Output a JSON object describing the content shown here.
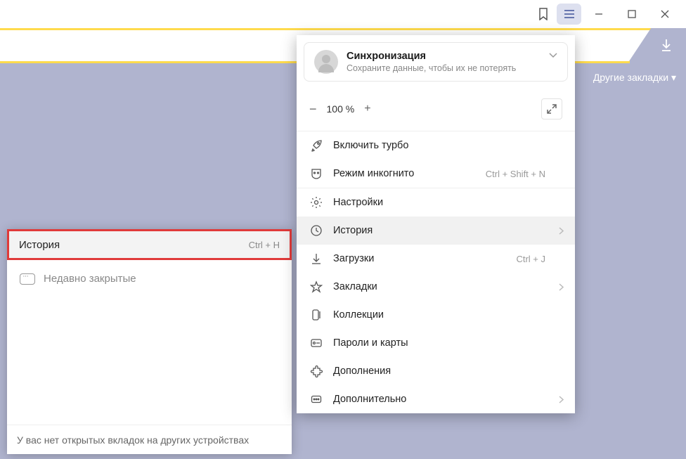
{
  "other_bookmarks": "Другие закладки ▾",
  "sync": {
    "title": "Синхронизация",
    "subtitle": "Сохраните данные, чтобы их не потерять"
  },
  "zoom": {
    "minus": "−",
    "value": "100 %",
    "plus": "+"
  },
  "menu": {
    "turbo": "Включить турбо",
    "incognito": "Режим инкогнито",
    "incognito_shortcut": "Ctrl + Shift + N",
    "settings": "Настройки",
    "history": "История",
    "downloads": "Загрузки",
    "downloads_shortcut": "Ctrl + J",
    "bookmarks": "Закладки",
    "collections": "Коллекции",
    "passwords": "Пароли и карты",
    "addons": "Дополнения",
    "more": "Дополнительно"
  },
  "history_panel": {
    "title": "История",
    "shortcut": "Ctrl + H",
    "recent": "Недавно закрытые",
    "footer": "У вас нет открытых вкладок на других устройствах"
  }
}
